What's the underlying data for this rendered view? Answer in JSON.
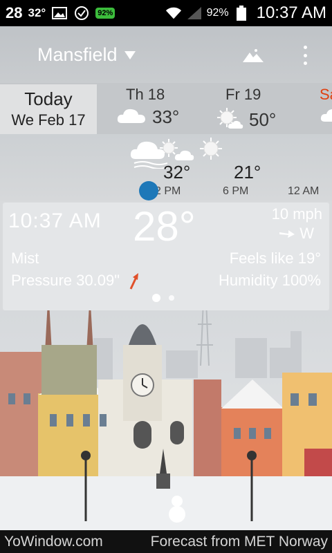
{
  "status_bar": {
    "temp_main": "28",
    "temp_secondary": "32°",
    "badge": "92%",
    "battery": "92%",
    "time": "10:37 AM"
  },
  "header": {
    "location": "Mansfield"
  },
  "days": {
    "today_label": "Today",
    "today_date": "We Feb 17",
    "items": [
      {
        "name": "Th 18",
        "temp": "33°"
      },
      {
        "name": "Fr 19",
        "temp": "50°"
      },
      {
        "name": "Sa"
      }
    ]
  },
  "hourly": {
    "temps": [
      "32°",
      "21°"
    ],
    "times": [
      "2 PM",
      "6 PM",
      "12 AM"
    ]
  },
  "current": {
    "time": "10:37 AM",
    "temperature": "28°",
    "wind_speed": "10 mph",
    "wind_direction": "W",
    "description": "Mist",
    "feels_like": "Feels like 19°",
    "pressure": "Pressure 30.09\"",
    "humidity": "Humidity 100%"
  },
  "footer": {
    "left": "YoWindow.com",
    "right": "Forecast from MET Norway"
  },
  "colors": {
    "accent_blue": "#1e78b8",
    "pressure_arrow": "#e0502a",
    "saturday_red": "#e04010"
  },
  "icons": {
    "status": [
      "image-icon",
      "check-circle-icon",
      "wifi-icon",
      "signal-icon",
      "battery-icon"
    ],
    "header": [
      "landscape-icon",
      "overflow-menu-icon",
      "dropdown-arrow-icon"
    ],
    "weather": [
      "cloud-icon",
      "partly-sunny-icon",
      "sun-icon",
      "cloud-rain-icon"
    ]
  }
}
